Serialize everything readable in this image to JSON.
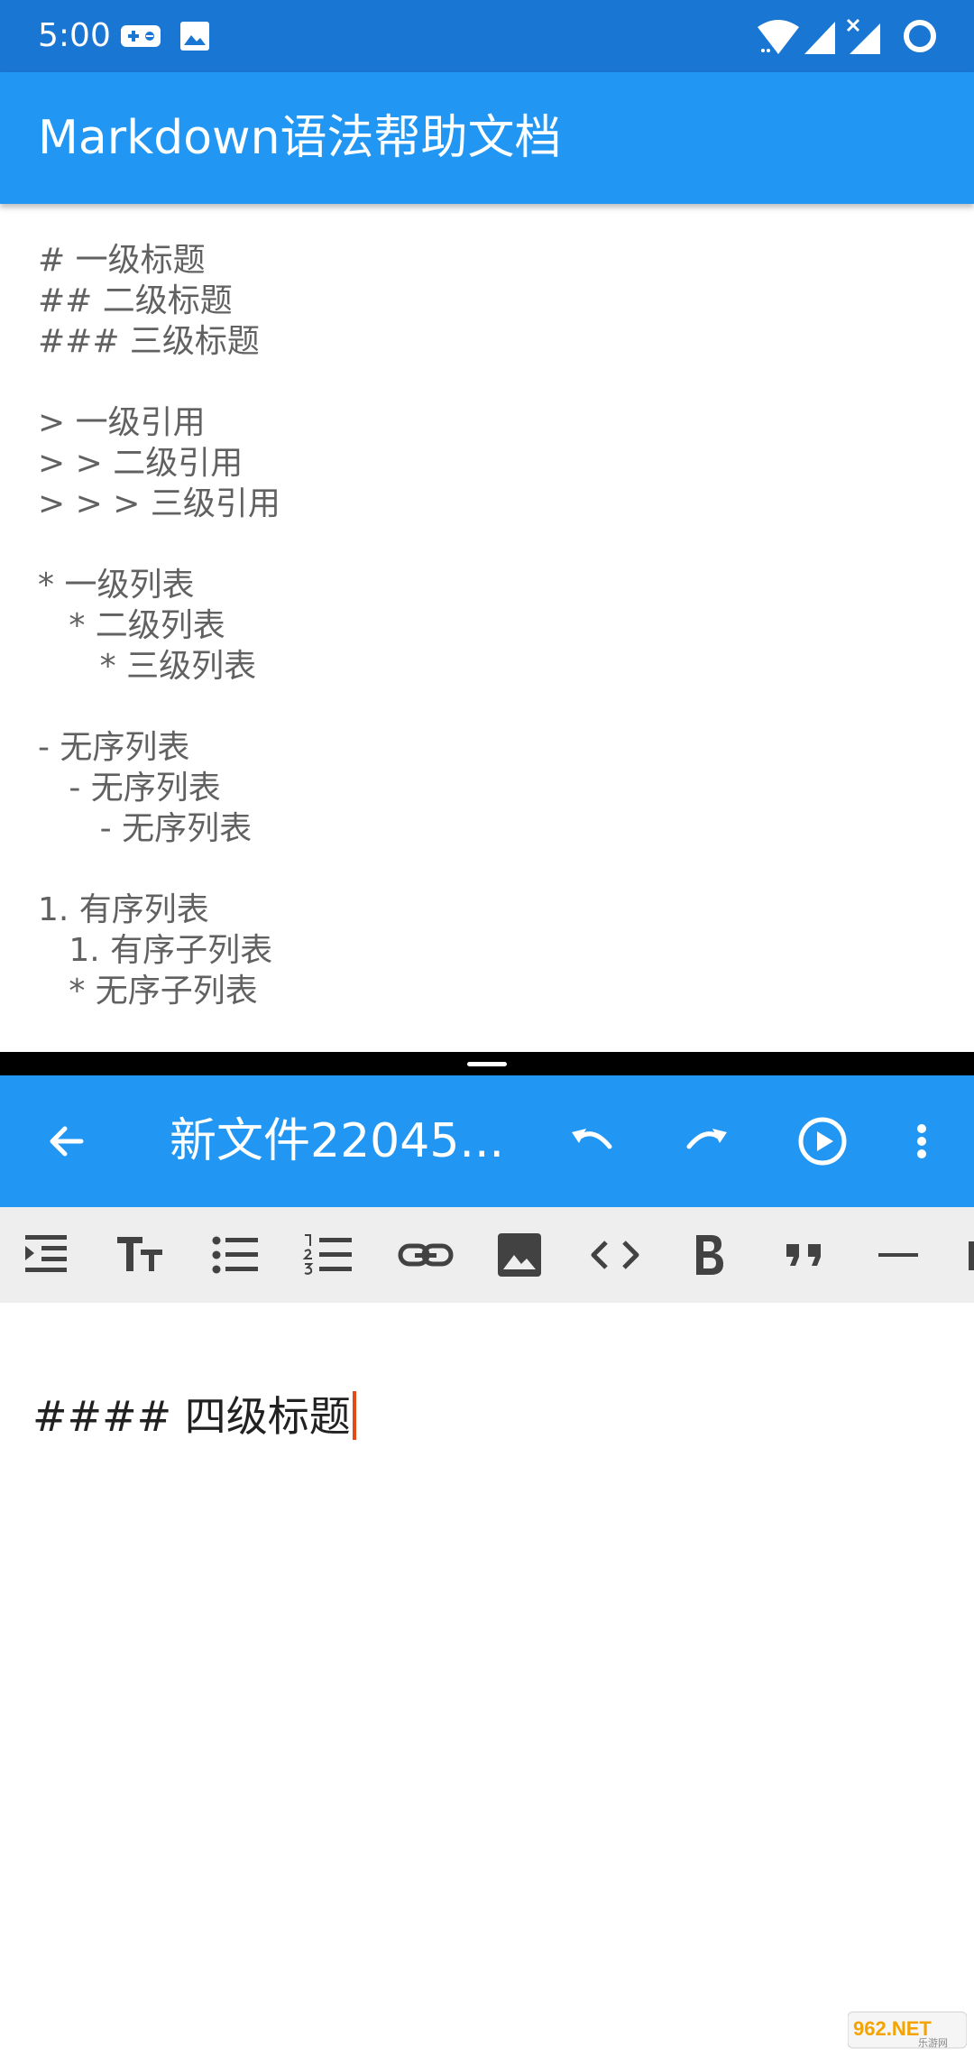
{
  "status_bar": {
    "time": "5:00"
  },
  "help_doc": {
    "title": "Markdown语法帮助文档",
    "lines": [
      "# 一级标题",
      "## 二级标题",
      "### 三级标题",
      "",
      "> 一级引用",
      "> > 二级引用",
      "> > > 三级引用",
      "",
      "* 一级列表",
      "   * 二级列表",
      "      * 三级列表",
      "",
      "- 无序列表",
      "   - 无序列表",
      "      - 无序列表",
      "",
      "1. 有序列表",
      "   1. 有序子列表",
      "   * 无序子列表"
    ]
  },
  "editor": {
    "title": "新文件22045...",
    "content": "#### 四级标题",
    "toolbar_icons": [
      "back-arrow-icon",
      "undo-icon",
      "redo-icon",
      "play-circle-icon",
      "more-vert-icon"
    ],
    "format_icons": [
      "indent-icon",
      "text-size-icon",
      "bulleted-list-icon",
      "numbered-list-icon",
      "link-icon",
      "image-icon",
      "code-icon",
      "bold-icon",
      "quote-icon",
      "horizontal-rule-icon"
    ]
  },
  "watermark": {
    "text": "962.NET",
    "sub": "乐游网"
  },
  "colors": {
    "status_bar": "#1976d2",
    "app_bar": "#2196f3",
    "toolbar_bg": "#eeeeee",
    "cursor": "#e64a19"
  }
}
